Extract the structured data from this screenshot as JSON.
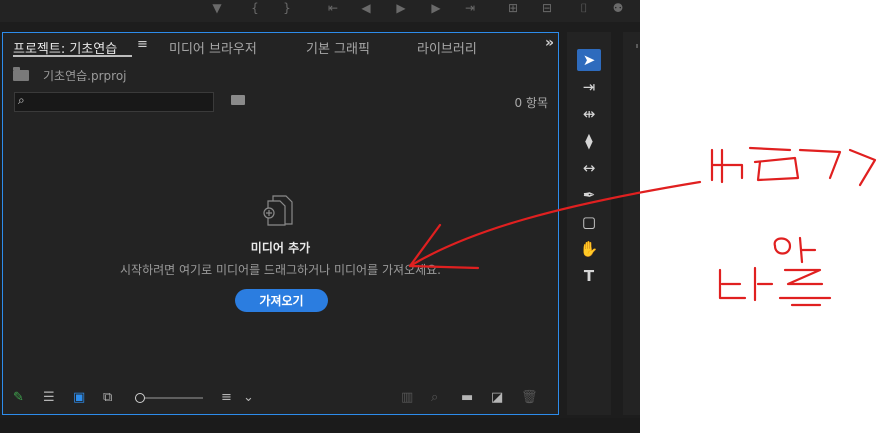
{
  "tabs": [
    {
      "label": "프로젝트: 기초연습",
      "active": true
    },
    {
      "label": "미디어 브라우저",
      "active": false
    },
    {
      "label": "기본 그래픽",
      "active": false
    },
    {
      "label": "라이브러리",
      "active": false
    }
  ],
  "tabs_more": "»",
  "tab_menu": "≡",
  "project": {
    "name": "기초연습.prproj"
  },
  "search": {
    "value": "",
    "icon": "⌕"
  },
  "item_count": "0 항목",
  "empty_state": {
    "title": "미디어 추가",
    "description": "시작하려면 여기로 미디어를 드래그하거나 미디어를 가져오세요.",
    "button_label": "가져오기"
  },
  "bottom_toolbar": {
    "pencil": "✎",
    "list": "☰",
    "icon_view": "▣",
    "freeform": "⧉",
    "sort": "≡",
    "sort_dropdown": "⌄",
    "automate": "▥",
    "find": "⌕",
    "new_bin": "▬",
    "new_item": "◪",
    "clear": "🗑"
  },
  "transport_icons": [
    "▼",
    "{",
    "}",
    "⇤",
    "◀",
    "▶",
    "▶",
    "⇥",
    "⊞",
    "⊟",
    "⌷",
    "⚉"
  ],
  "tools": [
    "➤",
    "⇥",
    "⇹",
    "⧫",
    "↔",
    "✒",
    "▢",
    "✋",
    "T"
  ],
  "colors": {
    "accent": "#2d8ceb",
    "button": "#2b7de0",
    "annotation": "#e02020"
  }
}
